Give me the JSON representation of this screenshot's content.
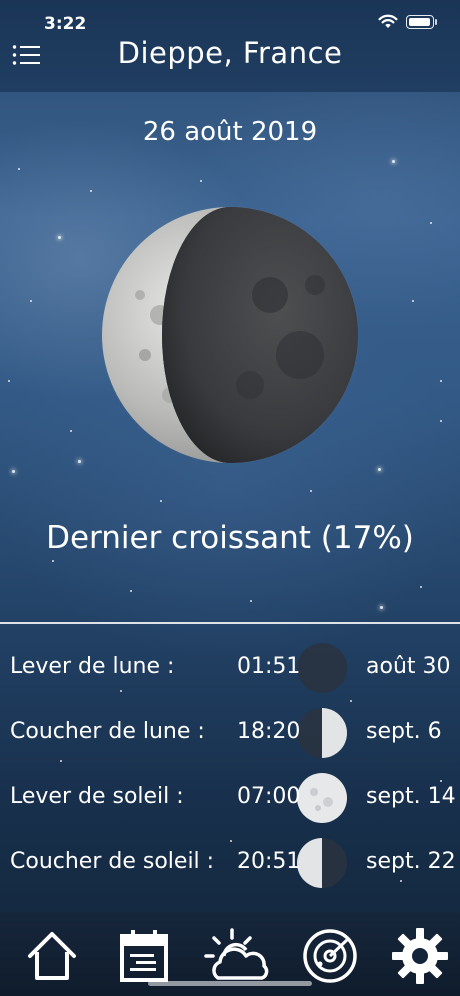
{
  "status_bar": {
    "time": "3:22"
  },
  "header": {
    "title": "Dieppe, France"
  },
  "date": "26 août 2019",
  "phase": {
    "label": "Dernier croissant (17%)",
    "illumination": 0.17
  },
  "rows": [
    {
      "label": "Lever de lune :",
      "value": "01:51",
      "phase_date": "août 30",
      "phase_icon": "new-moon-icon"
    },
    {
      "label": "Coucher de lune :",
      "value": "18:20",
      "phase_date": "sept. 6",
      "phase_icon": "first-quarter-moon-icon"
    },
    {
      "label": "Lever de soleil :",
      "value": "07:00",
      "phase_date": "sept. 14",
      "phase_icon": "full-moon-icon"
    },
    {
      "label": "Coucher de soleil :",
      "value": "20:51",
      "phase_date": "sept. 22",
      "phase_icon": "last-quarter-moon-icon"
    }
  ],
  "tabs": [
    {
      "name": "home-icon"
    },
    {
      "name": "calendar-icon"
    },
    {
      "name": "weather-icon"
    },
    {
      "name": "radar-icon"
    },
    {
      "name": "gear-icon"
    }
  ]
}
